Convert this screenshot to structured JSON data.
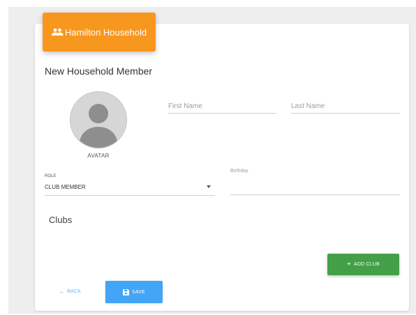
{
  "header": {
    "title": "Hamilton Household",
    "icon": "people-icon"
  },
  "form": {
    "title": "New Household Member",
    "avatar_label": "AVATAR",
    "first_name_placeholder": "First Name",
    "last_name_placeholder": "Last Name",
    "role_label": "ROLE",
    "role_value": "CLUB MEMBER",
    "birthday_label": "Birthday",
    "clubs_title": "Clubs"
  },
  "actions": {
    "add_club_label": "ADD CLUB",
    "back_label": "BACK",
    "save_label": "SAVE"
  },
  "colors": {
    "header": "#f7971e",
    "add_club": "#43a047",
    "save": "#42a5f5",
    "back": "#64b5f6"
  }
}
